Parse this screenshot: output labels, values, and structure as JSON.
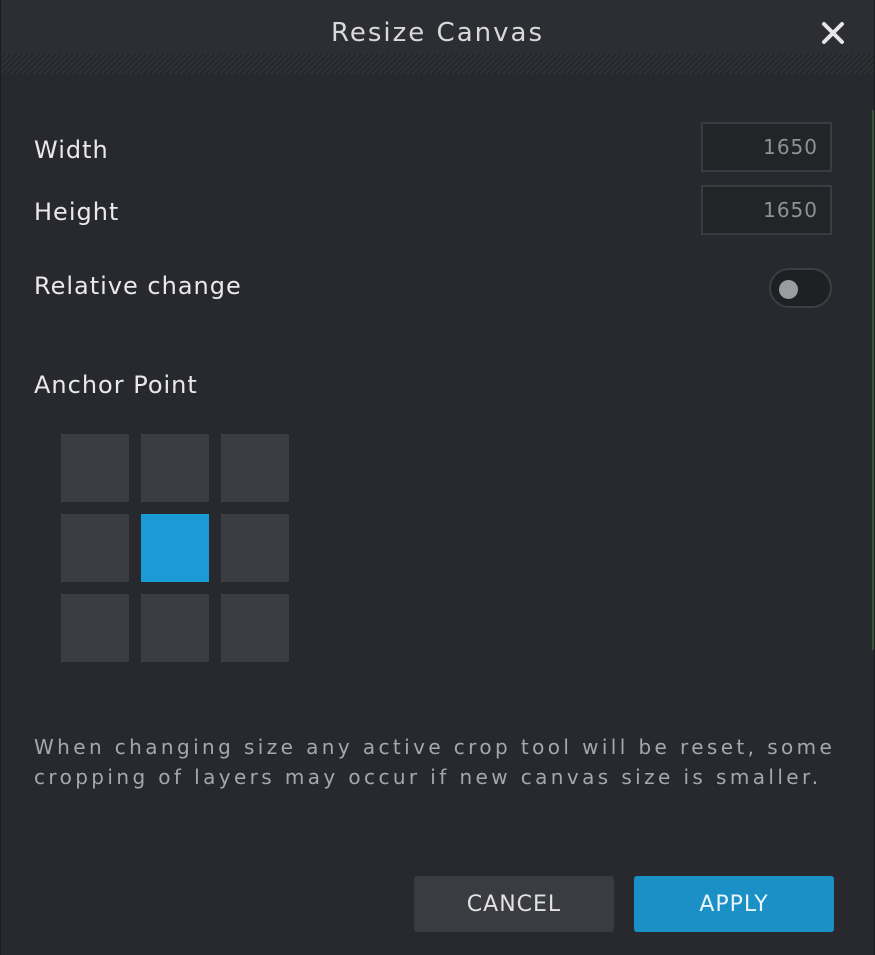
{
  "dialog": {
    "title": "Resize Canvas",
    "close_icon": "close-icon"
  },
  "width": {
    "label": "Width",
    "value": "1650"
  },
  "height": {
    "label": "Height",
    "value": "1650"
  },
  "relative_change": {
    "label": "Relative change",
    "enabled": false
  },
  "anchor": {
    "label": "Anchor Point",
    "selected": "middle-center",
    "cells": [
      "top-left",
      "top-center",
      "top-right",
      "middle-left",
      "middle-center",
      "middle-right",
      "bottom-left",
      "bottom-center",
      "bottom-right"
    ]
  },
  "note": "When changing size any active crop tool will be reset, some cropping of layers may occur if new canvas size is smaller.",
  "buttons": {
    "cancel": "CANCEL",
    "apply": "APPLY"
  },
  "colors": {
    "accent": "#1a9bd7",
    "background": "#28292e",
    "cell": "#3b3d42"
  }
}
